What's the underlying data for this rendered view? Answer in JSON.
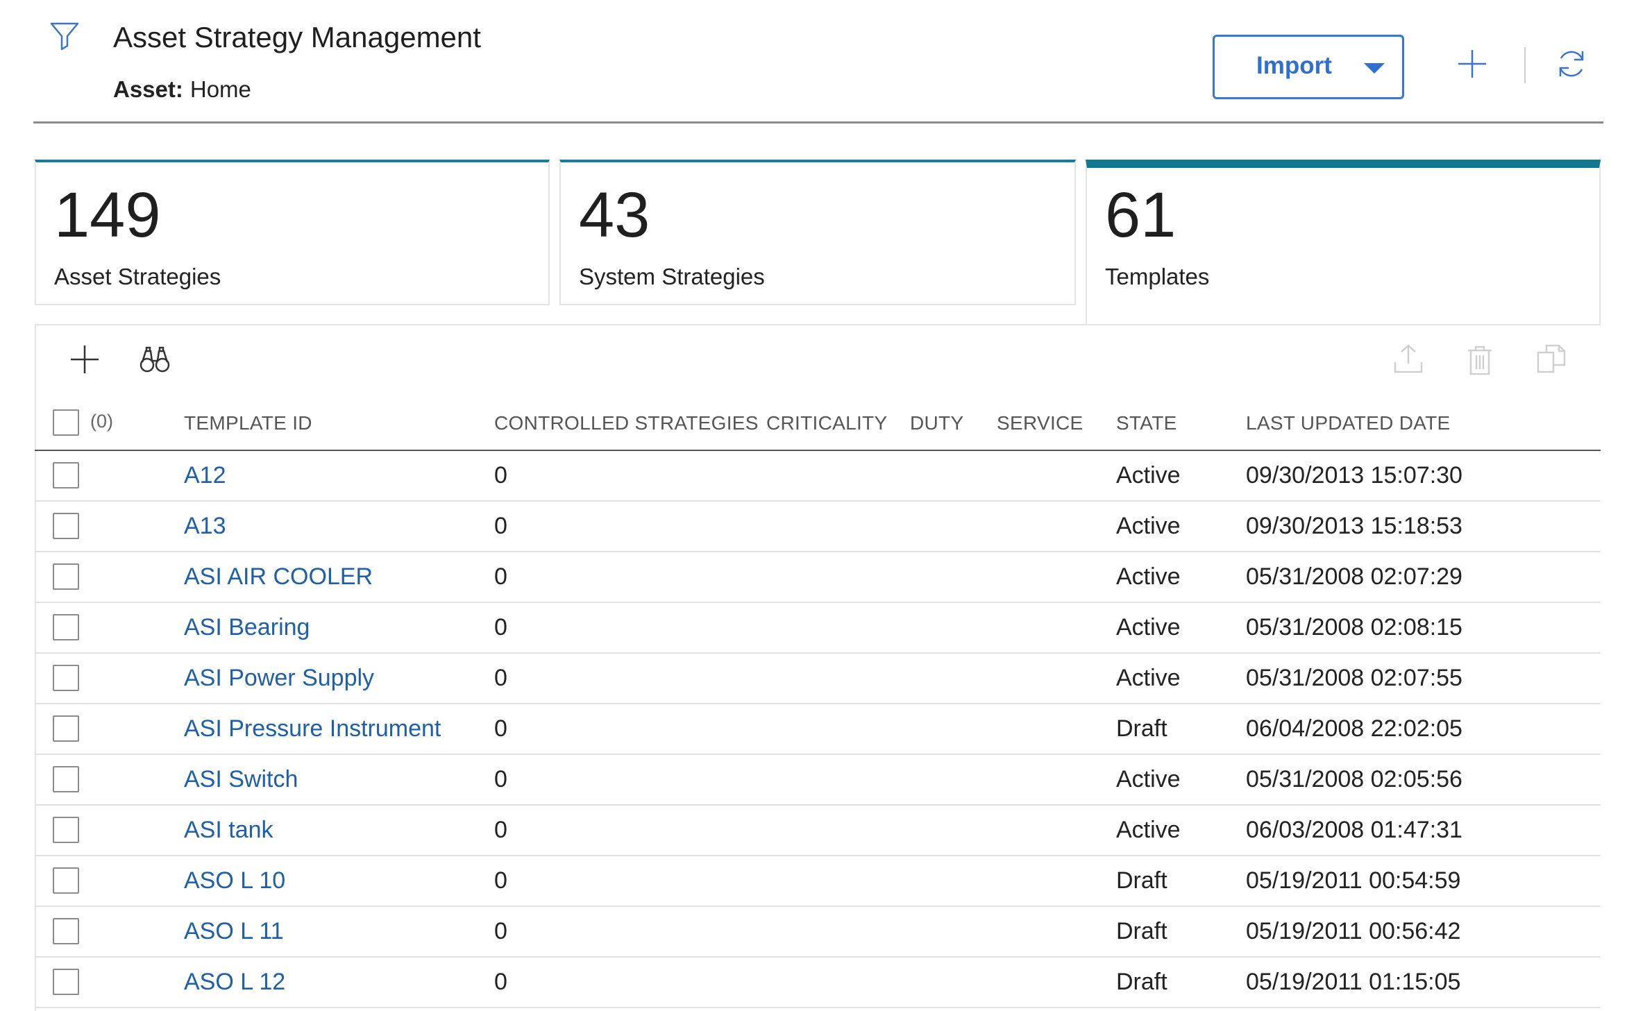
{
  "header": {
    "title": "Asset Strategy Management",
    "breadcrumb_label": "Asset:",
    "breadcrumb_value": "Home",
    "import_label": "Import",
    "accent": "#2f6fcf"
  },
  "cards": [
    {
      "count": "149",
      "caption": "Asset Strategies"
    },
    {
      "count": "43",
      "caption": "System Strategies"
    },
    {
      "count": "61",
      "caption": "Templates"
    }
  ],
  "table": {
    "selected_count": "(0)",
    "columns": {
      "template_id": "TEMPLATE ID",
      "controlled_strategies": "CONTROLLED STRATEGIES",
      "criticality": "CRITICALITY",
      "duty": "DUTY",
      "service": "SERVICE",
      "state": "STATE",
      "last_updated": "LAST UPDATED DATE"
    },
    "rows": [
      {
        "id": "A12",
        "controlled": "0",
        "state": "Active",
        "updated": "09/30/2013 15:07:30"
      },
      {
        "id": "A13",
        "controlled": "0",
        "state": "Active",
        "updated": "09/30/2013 15:18:53"
      },
      {
        "id": "ASI AIR COOLER",
        "controlled": "0",
        "state": "Active",
        "updated": "05/31/2008 02:07:29"
      },
      {
        "id": "ASI Bearing",
        "controlled": "0",
        "state": "Active",
        "updated": "05/31/2008 02:08:15"
      },
      {
        "id": "ASI Power Supply",
        "controlled": "0",
        "state": "Active",
        "updated": "05/31/2008 02:07:55"
      },
      {
        "id": "ASI Pressure Instrument",
        "controlled": "0",
        "state": "Draft",
        "updated": "06/04/2008 22:02:05"
      },
      {
        "id": "ASI Switch",
        "controlled": "0",
        "state": "Active",
        "updated": "05/31/2008 02:05:56"
      },
      {
        "id": "ASI tank",
        "controlled": "0",
        "state": "Active",
        "updated": "06/03/2008 01:47:31"
      },
      {
        "id": "ASO L 10",
        "controlled": "0",
        "state": "Draft",
        "updated": "05/19/2011 00:54:59"
      },
      {
        "id": "ASO L 11",
        "controlled": "0",
        "state": "Draft",
        "updated": "05/19/2011 00:56:42"
      },
      {
        "id": "ASO L 12",
        "controlled": "0",
        "state": "Draft",
        "updated": "05/19/2011 01:15:05"
      }
    ]
  },
  "icons": {
    "filter": "filter-icon",
    "add": "plus-icon",
    "refresh": "refresh-icon",
    "find": "binoculars-icon",
    "upload": "upload-icon",
    "delete": "trash-icon",
    "copy": "copy-icon"
  }
}
